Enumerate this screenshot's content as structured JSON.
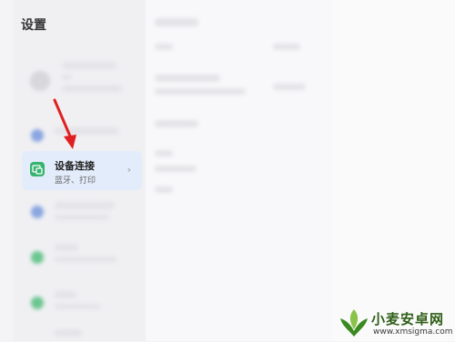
{
  "sidebar": {
    "title": "设置",
    "selected_item": {
      "title": "设备连接",
      "subtitle": "蓝牙、打印",
      "icon": "device-link-icon",
      "chevron": "›"
    }
  },
  "watermark": {
    "title": "小麦安卓网",
    "url": "www.xmsigma.com"
  },
  "colors": {
    "selected_bg": "#e3ecfb",
    "icon_green": "#35b36f",
    "arrow_red": "#e02020"
  }
}
